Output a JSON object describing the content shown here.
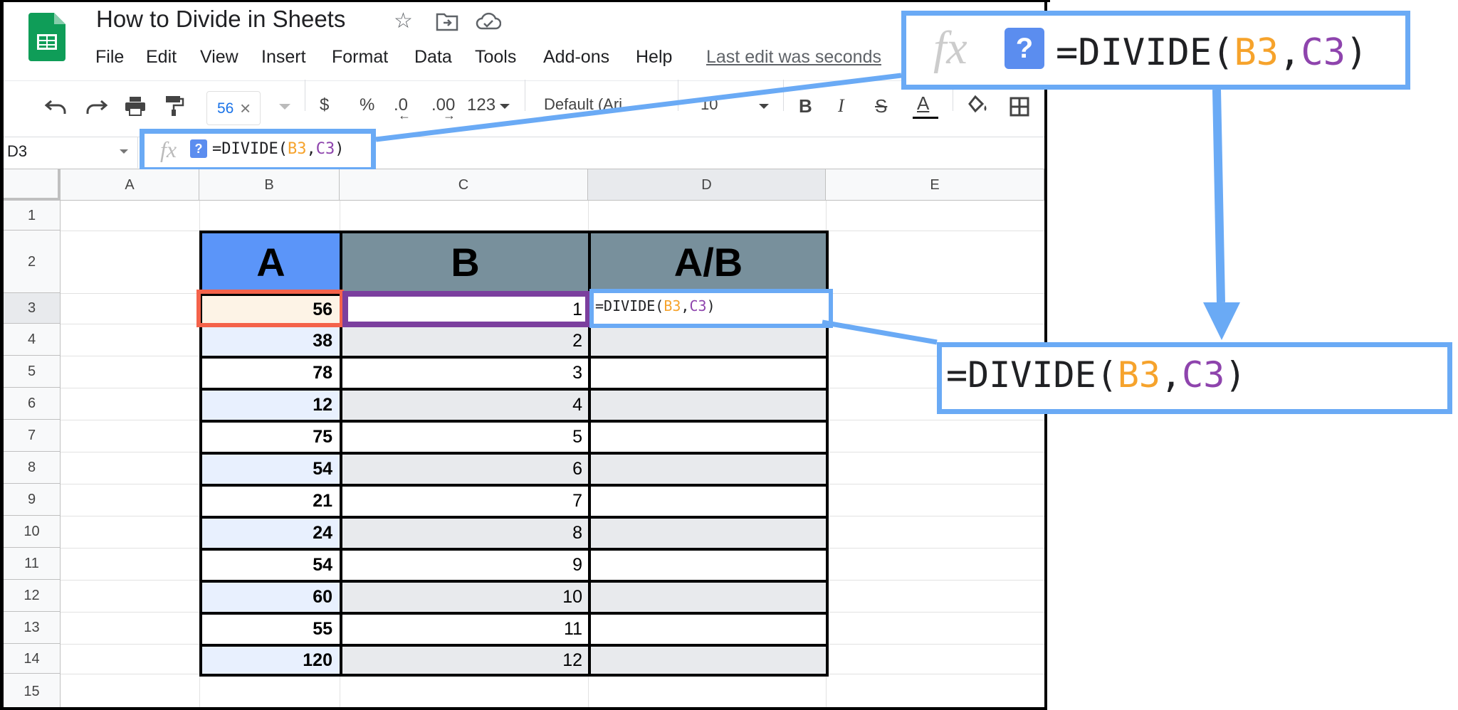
{
  "app": {
    "doc_title": "How to Divide in Sheets",
    "menu": [
      "File",
      "Edit",
      "View",
      "Insert",
      "Format",
      "Data",
      "Tools",
      "Add-ons",
      "Help"
    ],
    "last_edit": "Last edit was seconds"
  },
  "toolbar": {
    "suggestion_chip": "56",
    "chip_close": "×",
    "currency": "$",
    "percent": "%",
    "decrease_decimal": ".0",
    "increase_decimal": ".00",
    "number_format": "123",
    "font": "Default (Ari...",
    "font_size": "10",
    "bold": "B",
    "italic": "I",
    "strike": "S",
    "text_color": "A"
  },
  "formula_bar": {
    "name_box": "D3",
    "fx": "fx",
    "help": "?",
    "formula_prefix": "=DIVIDE(",
    "arg1": "B3",
    "comma": ",",
    "arg2": "C3",
    "formula_suffix": ")"
  },
  "sheet": {
    "columns": [
      "A",
      "B",
      "C",
      "D",
      "E"
    ],
    "rows": [
      "1",
      "2",
      "3",
      "4",
      "5",
      "6",
      "7",
      "8",
      "9",
      "10",
      "11",
      "12",
      "13",
      "14",
      "15"
    ],
    "table_headers": [
      "A",
      "B",
      "A/B"
    ],
    "col_a_values": [
      "56",
      "38",
      "78",
      "12",
      "75",
      "54",
      "21",
      "24",
      "54",
      "60",
      "55",
      "120"
    ],
    "col_b_values": [
      "1",
      "2",
      "3",
      "4",
      "5",
      "6",
      "7",
      "8",
      "9",
      "10",
      "11",
      "12"
    ],
    "active_cell_formula": {
      "prefix": "=DIVIDE(",
      "arg1": "B3",
      "comma": ",",
      "arg2": "C3",
      "suffix": ")"
    }
  },
  "colors": {
    "header_a": "#5b95f9",
    "header_gray": "#78909c",
    "band_light": "#e8f0fe",
    "band_gray": "#e8eaed",
    "callout_blue": "#6aaaf5",
    "b3_highlight": "#f4624a",
    "c3_highlight": "#7b3f9e",
    "ref_orange": "#f6a32c",
    "ref_purple": "#8e44ad"
  },
  "icons": [
    "sheets-logo-icon",
    "star-icon",
    "move-folder-icon",
    "cloud-saved-icon",
    "undo-icon",
    "redo-icon",
    "print-icon",
    "paint-format-icon",
    "fill-color-icon",
    "borders-icon",
    "arrow-down-icon"
  ]
}
